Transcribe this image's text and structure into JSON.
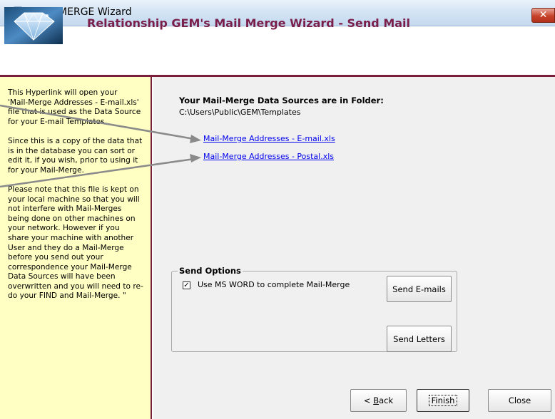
{
  "window": {
    "title": "MAIL MERGE Wizard",
    "close_glyph": "✕",
    "icon": "gem-icon"
  },
  "header": {
    "title": "Relationship GEM's Mail Merge Wizard - Send Mail",
    "logo": "diamond-logo"
  },
  "help": {
    "paragraphs": [
      "This Hyperlink will open your\n'Mail-Merge Addresses - E-mail.xls'\nfile that is used as the Data Source\nfor your E-mail Templates.",
      "Since this is a copy of the data that\nis in the database you can sort or\nedit it, if you wish, prior to using it\nfor your Mail-Merge.",
      "Please note that this file is kept on\nyour local machine so that you will\nnot interfere with Mail-Merges\nbeing done on other machines on\nyour network.  However if you\nshare your machine with another\nUser and they do a Mail-Merge\nbefore you send out your\ncorrespondence your Mail-Merge\nData Sources will have been\noverwritten and you will need to re-\ndo your FIND and Mail-Merge.  \""
    ]
  },
  "sources": {
    "heading": "Your Mail-Merge Data Sources are in Folder:",
    "path": "C:\\Users\\Public\\GEM\\Templates",
    "links": [
      "Mail-Merge Addresses - E-mail.xls",
      "Mail-Merge Addresses - Postal.xls"
    ]
  },
  "send_options": {
    "legend": "Send Options",
    "checkbox_label": "Use MS WORD to complete Mail-Merge",
    "checkbox_checked": true,
    "send_emails": "Send E-mails",
    "send_letters": "Send Letters"
  },
  "footer": {
    "back_prefix": "< ",
    "back_accel": "B",
    "back_rest": "ack",
    "finish": "Finish",
    "close": "Close"
  },
  "colors": {
    "accent": "#7a1e3c",
    "help_bg": "#ffffc4",
    "link": "#0000ee"
  }
}
